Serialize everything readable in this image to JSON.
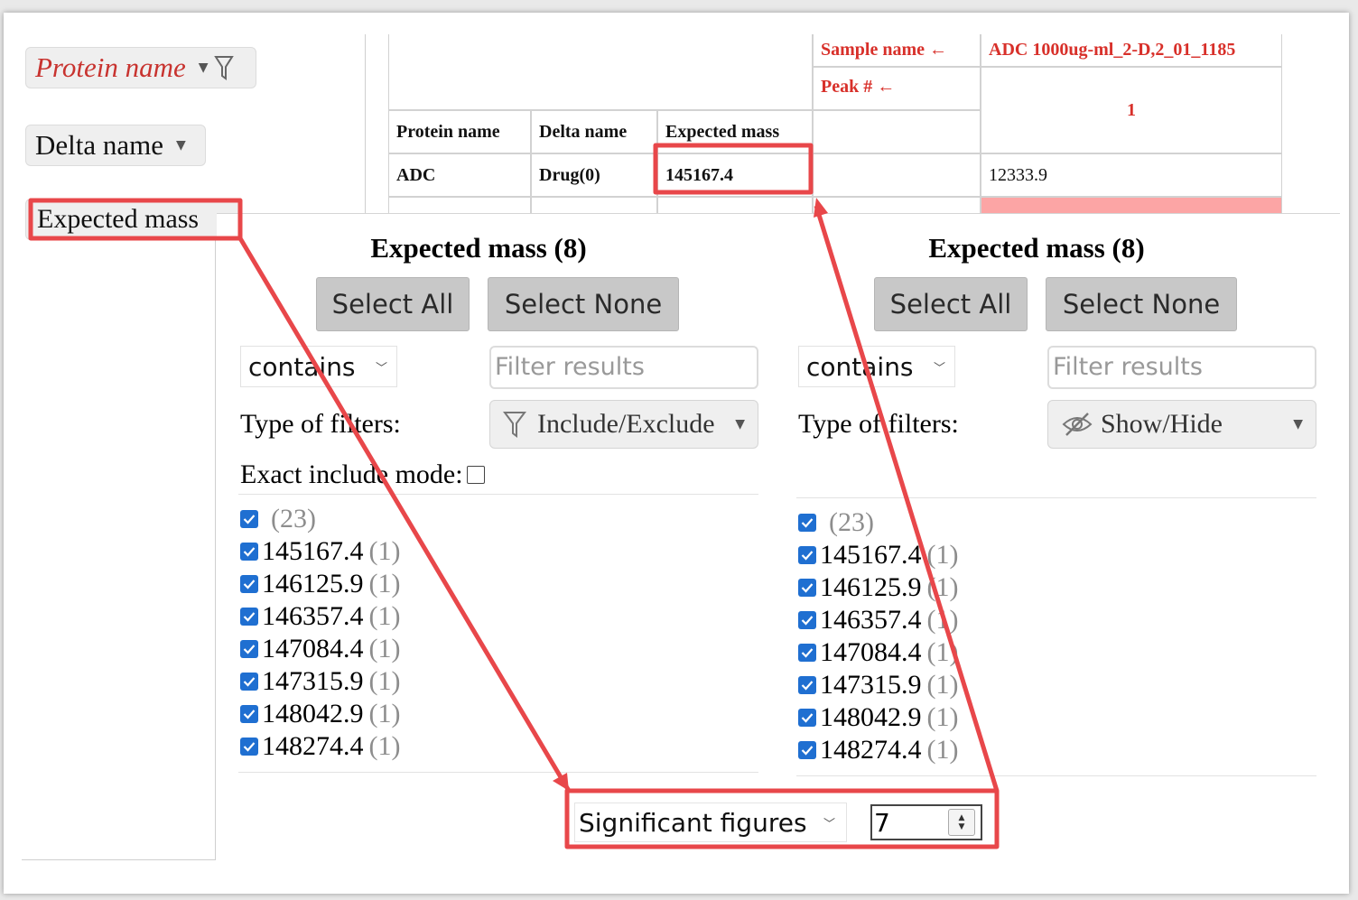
{
  "fields": {
    "protein_name": "Protein name",
    "delta_name": "Delta name",
    "expected_mass": "Expected mass"
  },
  "table": {
    "sample_label": "Sample name ←",
    "sample_value": "ADC 1000ug-ml_2-D,2_01_1185",
    "peak_label": "Peak # ←",
    "peak_value": "1",
    "col_protein": "Protein name",
    "col_delta": "Delta name",
    "col_expected": "Expected mass",
    "row1_protein": "ADC",
    "row1_delta": "Drug(0)",
    "row1_expected": "145167.4",
    "row1_value": "12333.9"
  },
  "panels": [
    {
      "title": "Expected mass (8)",
      "select_all": "Select All",
      "select_none": "Select None",
      "match_mode": "contains",
      "filter_placeholder": "Filter results",
      "filter_type_label": "Type of filters:",
      "filter_type": "Include/Exclude",
      "exact_label": "Exact include mode:",
      "items": [
        {
          "value": "",
          "count": "(23)"
        },
        {
          "value": "145167.4",
          "count": "(1)"
        },
        {
          "value": "146125.9",
          "count": "(1)"
        },
        {
          "value": "146357.4",
          "count": "(1)"
        },
        {
          "value": "147084.4",
          "count": "(1)"
        },
        {
          "value": "147315.9",
          "count": "(1)"
        },
        {
          "value": "148042.9",
          "count": "(1)"
        },
        {
          "value": "148274.4",
          "count": "(1)"
        }
      ]
    },
    {
      "title": "Expected mass (8)",
      "select_all": "Select All",
      "select_none": "Select None",
      "match_mode": "contains",
      "filter_placeholder": "Filter results",
      "filter_type_label": "Type of filters:",
      "filter_type": "Show/Hide",
      "items": [
        {
          "value": "",
          "count": "(23)"
        },
        {
          "value": "145167.4",
          "count": "(1)"
        },
        {
          "value": "146125.9",
          "count": "(1)"
        },
        {
          "value": "146357.4",
          "count": "(1)"
        },
        {
          "value": "147084.4",
          "count": "(1)"
        },
        {
          "value": "147315.9",
          "count": "(1)"
        },
        {
          "value": "148042.9",
          "count": "(1)"
        },
        {
          "value": "148274.4",
          "count": "(1)"
        }
      ]
    }
  ],
  "significant_figures": {
    "label": "Significant figures",
    "value": "7"
  },
  "colors": {
    "annotation": "#e8474a",
    "checkbox": "#1f6fd1",
    "highlight_cell": "#fca5a5"
  }
}
